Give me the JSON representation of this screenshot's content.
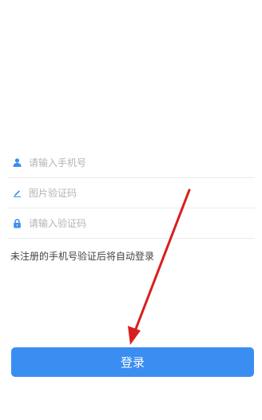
{
  "form": {
    "phone": {
      "placeholder": "请输入手机号",
      "icon": "user-icon"
    },
    "image_code": {
      "placeholder": "图片验证码",
      "icon": "pencil-icon"
    },
    "sms_code": {
      "placeholder": "请输入验证码",
      "icon": "lock-icon"
    }
  },
  "hint": "未注册的手机号验证后将自动登录",
  "login_button": "登录",
  "colors": {
    "accent": "#3a8ef2",
    "annotation": "#d81f1f"
  }
}
